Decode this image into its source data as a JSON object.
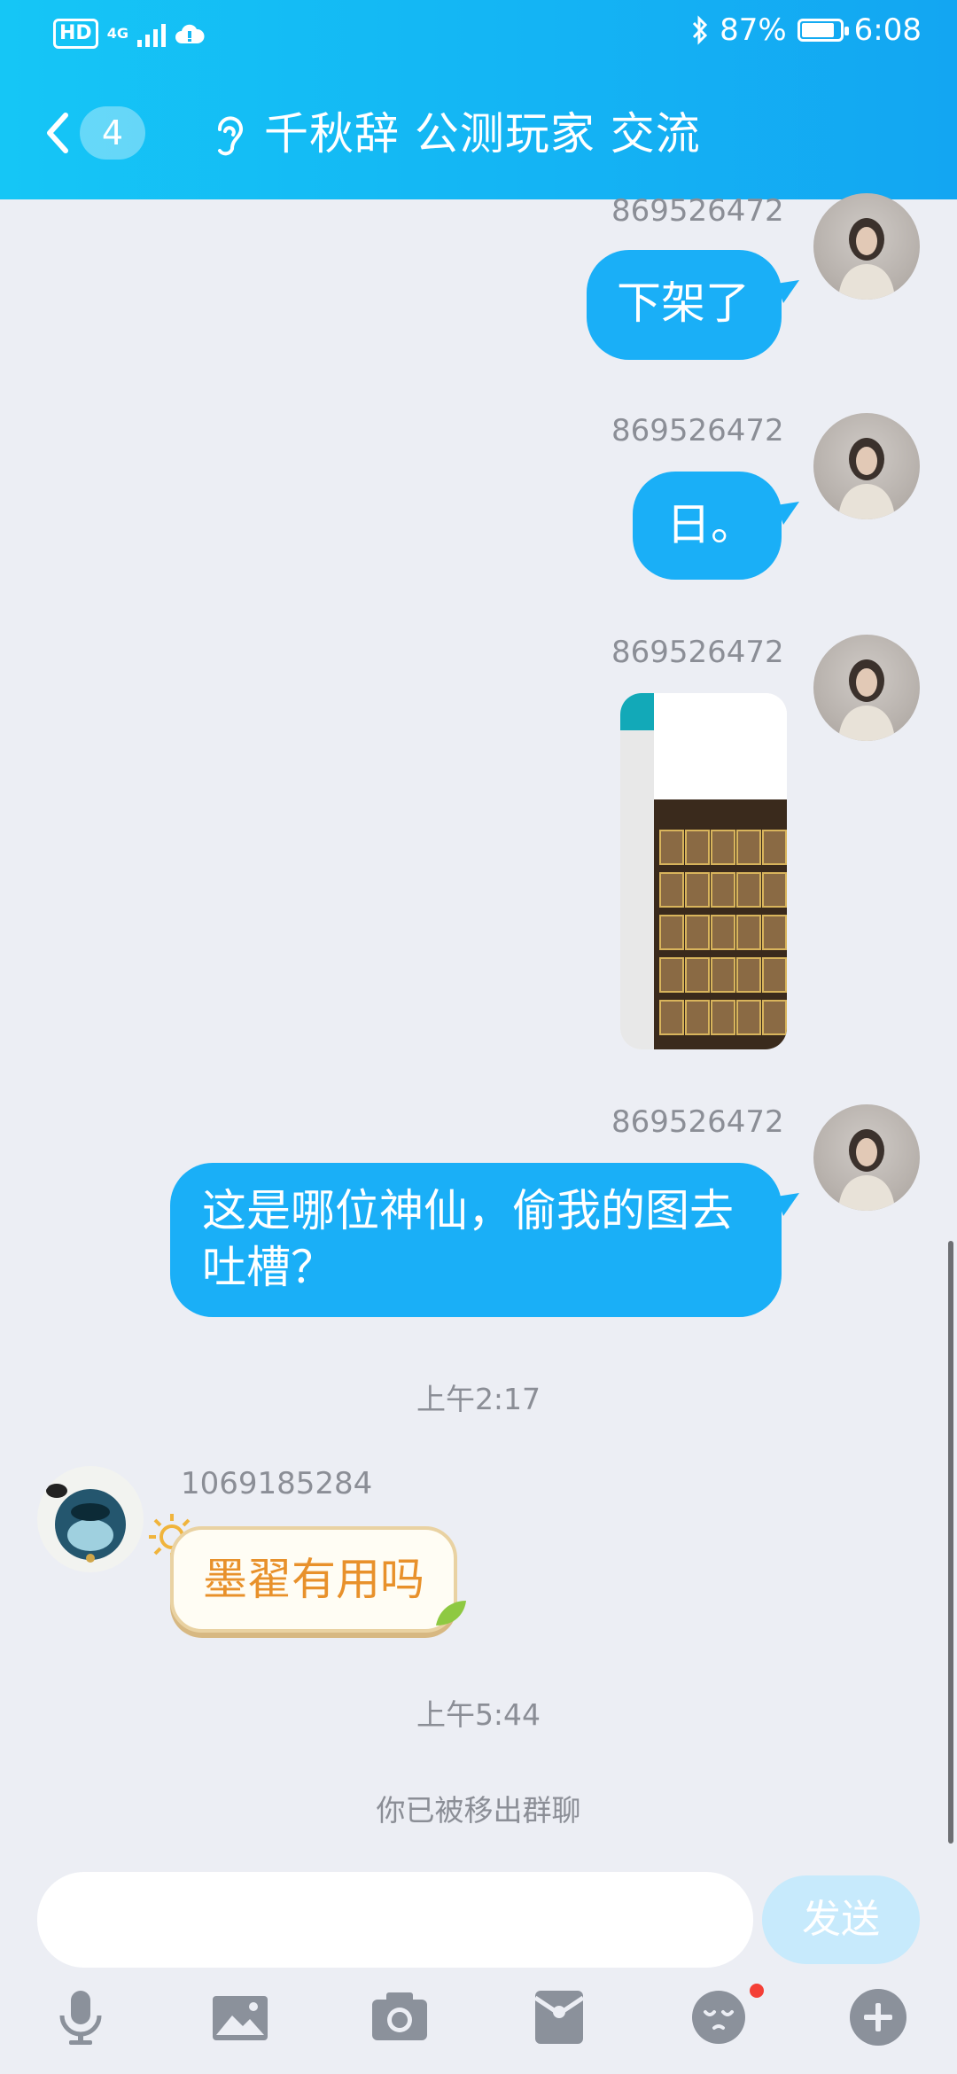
{
  "status_bar": {
    "hd": "HD",
    "network": "4G",
    "battery_percent": "87%",
    "battery_level": 0.87,
    "time": "6:08"
  },
  "header": {
    "unread_count": "4",
    "title": "千秋辞 公测玩家 交流"
  },
  "messages": [
    {
      "sender": "869526472",
      "text": "下架了"
    },
    {
      "sender": "869526472",
      "text": "日。"
    },
    {
      "sender": "869526472",
      "type": "image"
    },
    {
      "sender": "869526472",
      "text_line1": "这是哪位神仙，偷我的图去",
      "text_line2": "吐槽？"
    },
    {
      "timestamp": "上午2:17"
    },
    {
      "sender": "1069185284",
      "text": "墨翟有用吗"
    },
    {
      "timestamp": "上午5:44"
    },
    {
      "system": "你已被移出群聊"
    }
  ],
  "input": {
    "placeholder": "",
    "send_label": "发送"
  },
  "toolbar": {
    "icons": [
      "microphone-icon",
      "image-icon",
      "camera-icon",
      "red-packet-icon",
      "emoji-icon",
      "plus-icon"
    ]
  },
  "colors": {
    "header_start": "#15c6f6",
    "header_end": "#13a6f2",
    "bubble_out": "#1aaff7",
    "bubble_in_text": "#e8912b",
    "background": "#eceef4"
  }
}
